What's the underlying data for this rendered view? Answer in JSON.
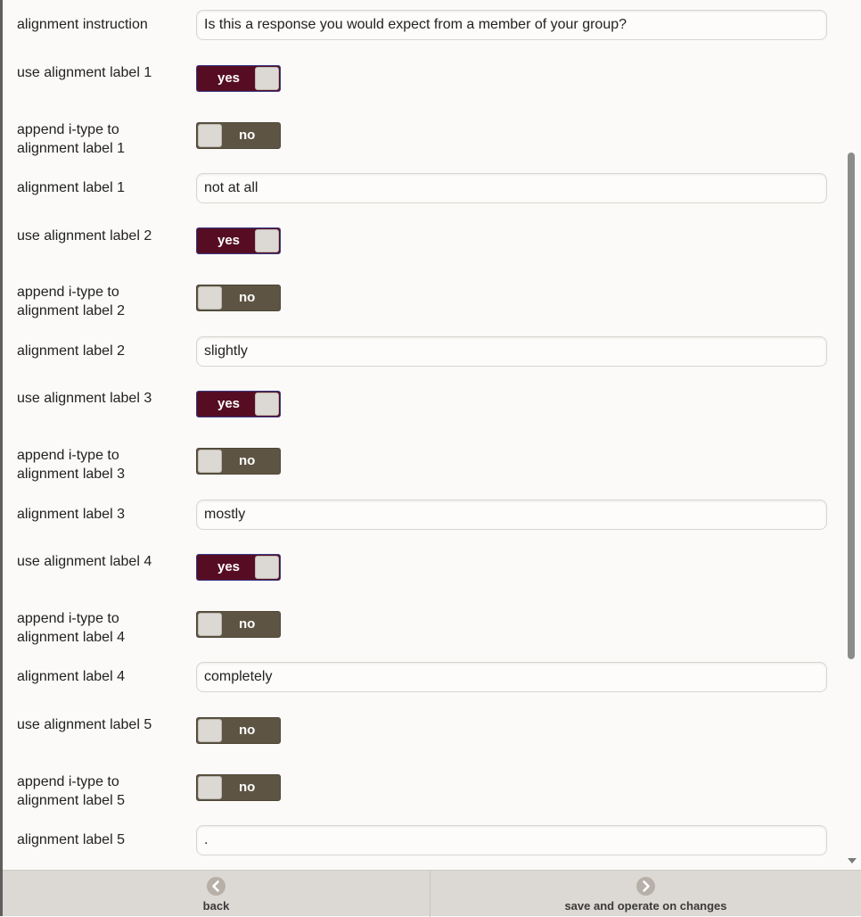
{
  "form": {
    "alignment_instruction": {
      "label": "alignment instruction",
      "value": "Is this a response you would expect from a member of your group?"
    },
    "labels": [
      {
        "use_label": "use alignment label 1",
        "use_value": "yes",
        "append_label": "append i-type to alignment label 1",
        "append_value": "no",
        "text_label": "alignment label 1",
        "text_value": "not at all"
      },
      {
        "use_label": "use alignment label 2",
        "use_value": "yes",
        "append_label": "append i-type to alignment label 2",
        "append_value": "no",
        "text_label": "alignment label 2",
        "text_value": "slightly"
      },
      {
        "use_label": "use alignment label 3",
        "use_value": "yes",
        "append_label": "append i-type to alignment label 3",
        "append_value": "no",
        "text_label": "alignment label 3",
        "text_value": "mostly"
      },
      {
        "use_label": "use alignment label 4",
        "use_value": "yes",
        "append_label": "append i-type to alignment label 4",
        "append_value": "no",
        "text_label": "alignment label 4",
        "text_value": "completely"
      },
      {
        "use_label": "use alignment label 5",
        "use_value": "no",
        "append_label": "append i-type to alignment label 5",
        "append_value": "no",
        "text_label": "alignment label 5",
        "text_value": "."
      }
    ]
  },
  "footer": {
    "back_label": "back",
    "save_label": "save and operate on changes",
    "back_icon": "chevron-left-icon",
    "save_icon": "chevron-right-icon"
  },
  "colors": {
    "toggle_on": "#560d24",
    "toggle_off": "#5d5443",
    "footer_bg": "#dcd8d3"
  }
}
